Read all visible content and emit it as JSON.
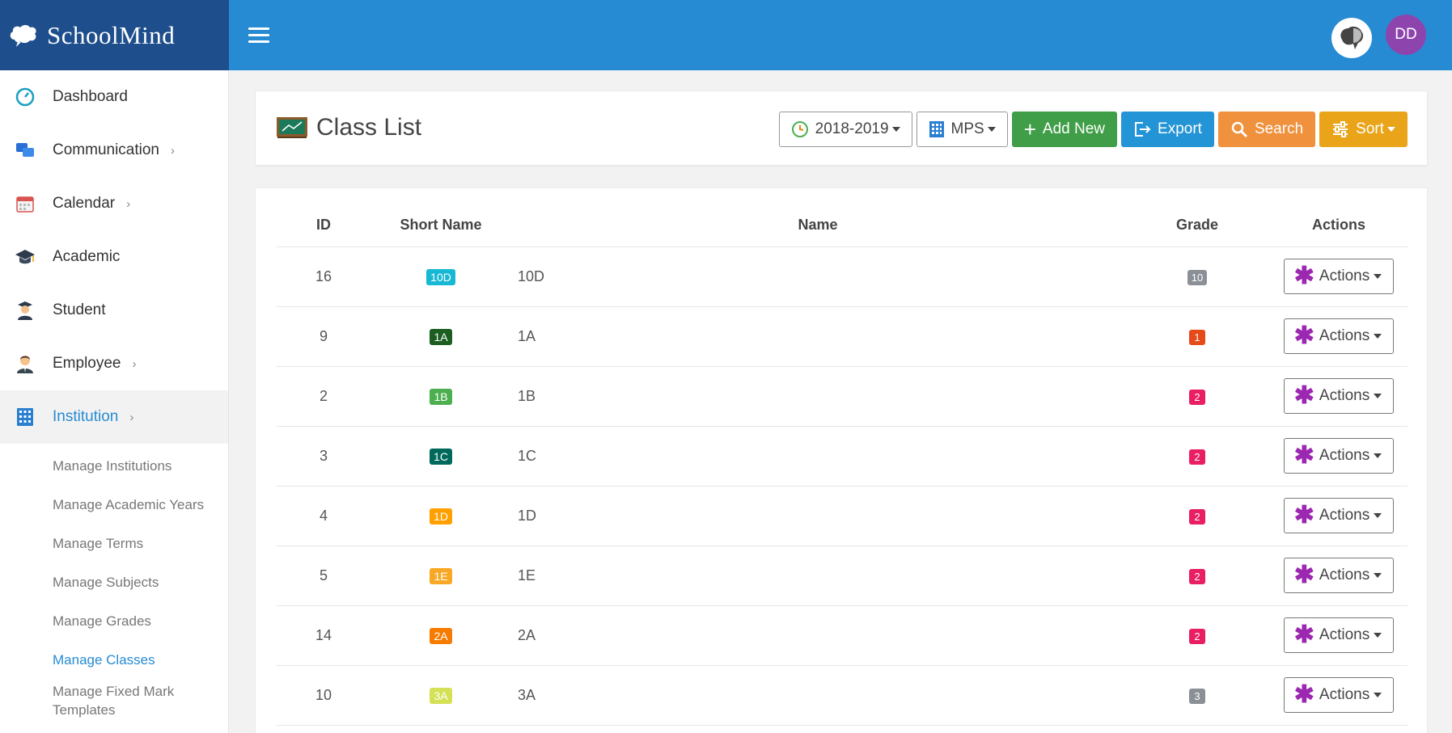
{
  "brand": {
    "name": "SchoolMind"
  },
  "header": {
    "user_initials": "DD"
  },
  "sidebar": {
    "items": [
      {
        "label": "Dashboard",
        "icon": "dashboard-icon",
        "has_children": false
      },
      {
        "label": "Communication",
        "icon": "chat-icon",
        "has_children": true
      },
      {
        "label": "Calendar",
        "icon": "calendar-icon",
        "has_children": true
      },
      {
        "label": "Academic",
        "icon": "graduation-cap-icon",
        "has_children": false
      },
      {
        "label": "Student",
        "icon": "student-icon",
        "has_children": false
      },
      {
        "label": "Employee",
        "icon": "employee-icon",
        "has_children": true
      },
      {
        "label": "Institution",
        "icon": "building-icon",
        "has_children": true,
        "active": true
      }
    ],
    "subitems": [
      {
        "label": "Manage Institutions"
      },
      {
        "label": "Manage Academic Years"
      },
      {
        "label": "Manage Terms"
      },
      {
        "label": "Manage Subjects"
      },
      {
        "label": "Manage Grades"
      },
      {
        "label": "Manage Classes",
        "active": true
      },
      {
        "label": "Manage Fixed Mark Templates"
      }
    ]
  },
  "page": {
    "title": "Class List",
    "toolbar": {
      "year": "2018-2019",
      "institution": "MPS",
      "add_new": "Add New",
      "export": "Export",
      "search": "Search",
      "sort": "Sort"
    }
  },
  "table": {
    "columns": {
      "id": "ID",
      "short_name": "Short Name",
      "name": "Name",
      "grade": "Grade",
      "actions": "Actions"
    },
    "rows": [
      {
        "id": "16",
        "short": "10D",
        "short_color": "#17b8d3",
        "name": "10D",
        "grade": "10",
        "grade_color": "#8a9096",
        "action": "Actions"
      },
      {
        "id": "9",
        "short": "1A",
        "short_color": "#1b5e20",
        "name": "1A",
        "grade": "1",
        "grade_color": "#e64a19",
        "action": "Actions"
      },
      {
        "id": "2",
        "short": "1B",
        "short_color": "#4caf50",
        "name": "1B",
        "grade": "2",
        "grade_color": "#e91e63",
        "action": "Actions"
      },
      {
        "id": "3",
        "short": "1C",
        "short_color": "#00695c",
        "name": "1C",
        "grade": "2",
        "grade_color": "#e91e63",
        "action": "Actions"
      },
      {
        "id": "4",
        "short": "1D",
        "short_color": "#ffa000",
        "name": "1D",
        "grade": "2",
        "grade_color": "#e91e63",
        "action": "Actions"
      },
      {
        "id": "5",
        "short": "1E",
        "short_color": "#f9a825",
        "name": "1E",
        "grade": "2",
        "grade_color": "#e91e63",
        "action": "Actions"
      },
      {
        "id": "14",
        "short": "2A",
        "short_color": "#f57c00",
        "name": "2A",
        "grade": "2",
        "grade_color": "#e91e63",
        "action": "Actions"
      },
      {
        "id": "10",
        "short": "3A",
        "short_color": "#d4e157",
        "name": "3A",
        "grade": "3",
        "grade_color": "#8a9096",
        "action": "Actions"
      }
    ]
  },
  "colors": {
    "brand_dark": "#1e4e8c",
    "topbar": "#268bd2",
    "active": "#268bd2",
    "avatar": "#8e44ad"
  }
}
